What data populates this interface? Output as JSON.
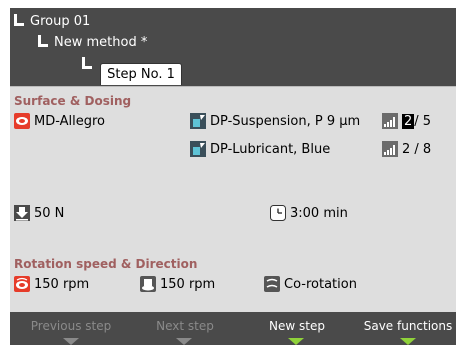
{
  "tree": {
    "group": "Group 01",
    "method": "New method *",
    "step_tab": "Step No. 1"
  },
  "surface_dosing": {
    "title": "Surface & Dosing",
    "surface": "MD-Allegro",
    "suspension": "DP-Suspension, P 9 µm",
    "lubricant": "DP-Lubricant, Blue",
    "suspension_level_current": "2",
    "suspension_level_rest": " / 5",
    "lubricant_level": "2 / 8"
  },
  "force": "50 N",
  "time": "3:00 min",
  "rotation": {
    "title": "Rotation speed & Direction",
    "disc_speed": "150 rpm",
    "holder_speed": "150 rpm",
    "direction": "Co-rotation"
  },
  "footer": {
    "prev": "Previous step",
    "next": "Next step",
    "new": "New step",
    "save": "Save functions"
  },
  "colors": {
    "header_bg": "#4a4a4a",
    "panel_bg": "#dedede",
    "section_title": "#a06060",
    "active_softkey": "#8fd23a"
  }
}
